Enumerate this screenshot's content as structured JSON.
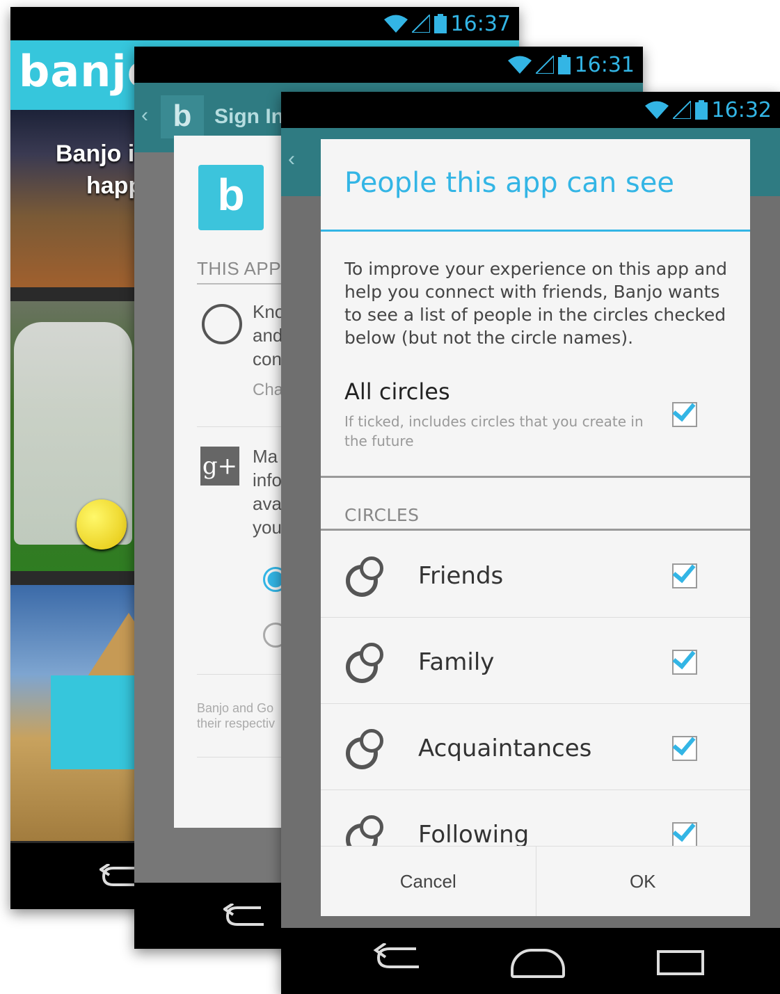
{
  "phone1": {
    "clock": "16:37",
    "logo": "banjo",
    "tagline_line1": "Banjo i",
    "tagline_line2": "happ"
  },
  "phone2": {
    "clock": "16:31",
    "back_glyph": "‹",
    "actionbar_logo": "b",
    "actionbar_title": "Sign In",
    "app_logo_letter": "b",
    "section_heading": "THIS APP",
    "perm1_lines": [
      "Kno",
      "and",
      "con"
    ],
    "perm1_sub": "Cha",
    "perm2_icon": "g+",
    "perm2_lines": [
      "Ma",
      "info",
      "ava",
      "you"
    ],
    "fine_print_line1": "Banjo and Go",
    "fine_print_line2": "their respectiv"
  },
  "phone3": {
    "clock": "16:32",
    "back_glyph": "‹",
    "dialog": {
      "title": "People this app can see",
      "description": "To improve your experience on this app and help you connect with friends, Banjo wants to see a list of people in the circles checked below (but not the circle names).",
      "all_circles": {
        "title": "All circles",
        "subtitle": "If ticked, includes circles that you create in the future",
        "checked": true
      },
      "circles_heading": "CIRCLES",
      "circles": [
        {
          "label": "Friends",
          "checked": true
        },
        {
          "label": "Family",
          "checked": true
        },
        {
          "label": "Acquaintances",
          "checked": true
        },
        {
          "label": "Following",
          "checked": true
        }
      ],
      "cancel_label": "Cancel",
      "ok_label": "OK"
    }
  },
  "colors": {
    "accent": "#33b5e5",
    "brand": "#36c6dc",
    "actionbar": "#2f7b82"
  },
  "icons": [
    "wifi-icon",
    "signal-icon",
    "battery-icon",
    "back-icon",
    "home-icon",
    "recent-apps-icon",
    "circle-icon",
    "checkbox-icon",
    "google-plus-icon",
    "person-icon",
    "radio-icon"
  ]
}
